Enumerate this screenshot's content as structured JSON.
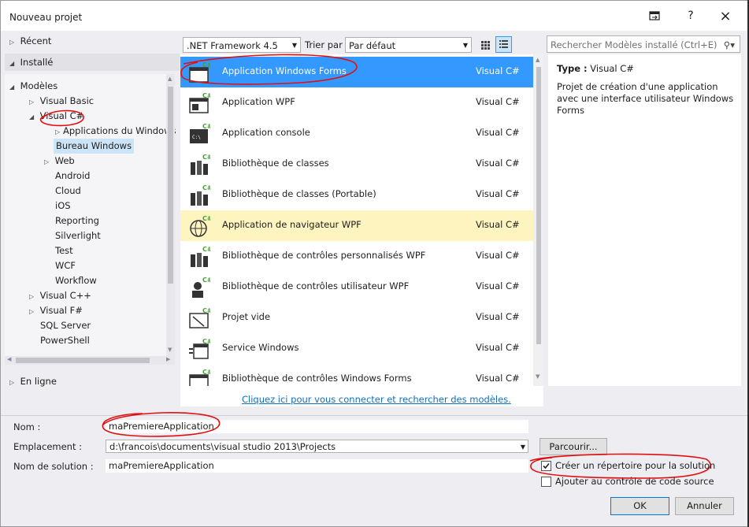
{
  "dialog": {
    "title": "Nouveau projet",
    "help": "?",
    "close": "×"
  },
  "tree": {
    "recent": "Récent",
    "installed": "Installé",
    "modeles": "Modèles",
    "items": [
      "Visual Basic",
      "Visual C#",
      "Applications du Windows",
      "Bureau Windows",
      "Web",
      "Android",
      "Cloud",
      "iOS",
      "Reporting",
      "Silverlight",
      "Test",
      "WCF",
      "Workflow",
      "Visual C++",
      "Visual F#",
      "SQL Server",
      "PowerShell"
    ],
    "online": "En ligne"
  },
  "toolbar": {
    "framework": ".NET Framework 4.5",
    "sort_label": "Trier par :",
    "sort_value": "Par défaut",
    "search_placeholder": "Rechercher Modèles installé (Ctrl+E)"
  },
  "templates": [
    {
      "name": "Application Windows Forms",
      "lang": "Visual C#",
      "icon": "winforms-icon"
    },
    {
      "name": "Application WPF",
      "lang": "Visual C#",
      "icon": "wpf-icon"
    },
    {
      "name": "Application console",
      "lang": "Visual C#",
      "icon": "console-icon"
    },
    {
      "name": "Bibliothèque de classes",
      "lang": "Visual C#",
      "icon": "class-library-icon"
    },
    {
      "name": "Bibliothèque de classes (Portable)",
      "lang": "Visual C#",
      "icon": "portable-library-icon"
    },
    {
      "name": "Application de navigateur WPF",
      "lang": "Visual C#",
      "icon": "browser-app-icon"
    },
    {
      "name": "Bibliothèque de contrôles personnalisés WPF",
      "lang": "Visual C#",
      "icon": "custom-control-icon"
    },
    {
      "name": "Bibliothèque de contrôles utilisateur WPF",
      "lang": "Visual C#",
      "icon": "user-control-icon"
    },
    {
      "name": "Projet vide",
      "lang": "Visual C#",
      "icon": "empty-project-icon"
    },
    {
      "name": "Service Windows",
      "lang": "Visual C#",
      "icon": "windows-service-icon"
    },
    {
      "name": "Bibliothèque de contrôles Windows Forms",
      "lang": "Visual C#",
      "icon": "winforms-control-icon"
    }
  ],
  "online_link": "Cliquez ici pour vous connecter et rechercher des modèles.",
  "details": {
    "type_label": "Type :",
    "type_value": "Visual C#",
    "description": "Projet de création d'une application avec une interface utilisateur Windows Forms"
  },
  "form": {
    "name_label": "Nom :",
    "name_value": "maPremiereApplication",
    "location_label": "Emplacement :",
    "location_value": "d:\\francois\\documents\\visual studio 2013\\Projects",
    "solution_label": "Nom de solution :",
    "solution_value": "maPremiereApplication",
    "browse": "Parcourir...",
    "create_dir": "Créer un répertoire pour la solution",
    "source_control": "Ajouter au contrôle de code source",
    "ok": "OK",
    "cancel": "Annuler"
  }
}
